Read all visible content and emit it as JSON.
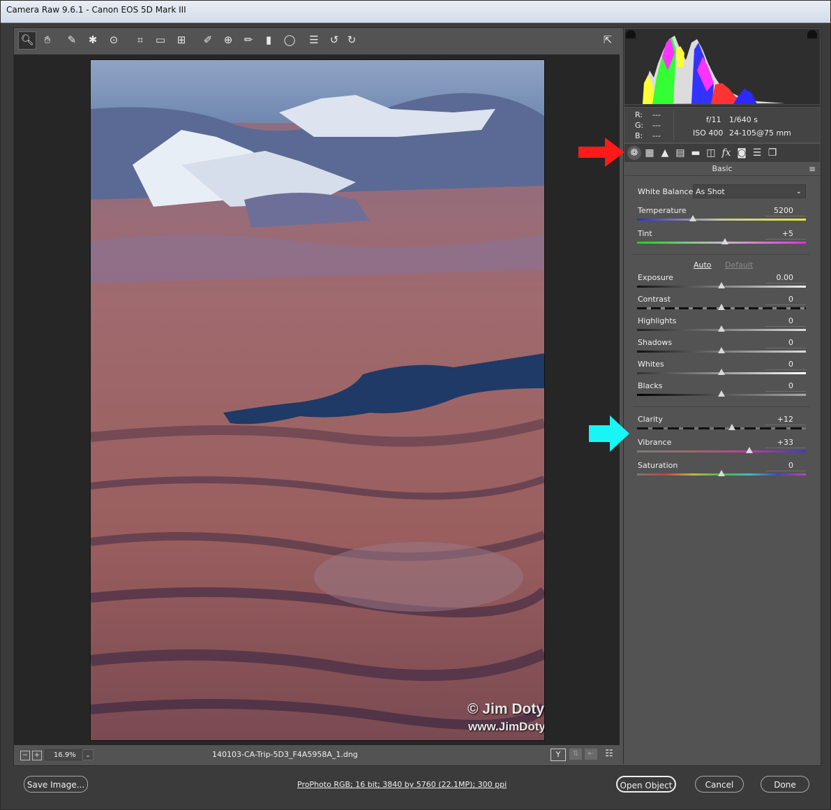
{
  "window": {
    "title": "Camera Raw 9.6.1  -  Canon EOS 5D Mark III"
  },
  "toolbar": {
    "tools": [
      {
        "name": "zoom-tool-icon",
        "glyph": "🔍︎"
      },
      {
        "name": "hand-tool-icon",
        "glyph": "✋︎"
      },
      {
        "name": "white-balance-tool-icon",
        "glyph": "✎"
      },
      {
        "name": "color-sampler-tool-icon",
        "glyph": "✱"
      },
      {
        "name": "targeted-adjustment-tool-icon",
        "glyph": "⊙"
      },
      {
        "name": "crop-tool-icon",
        "glyph": "⌗"
      },
      {
        "name": "straighten-tool-icon",
        "glyph": "▭"
      },
      {
        "name": "transform-tool-icon",
        "glyph": "⊞"
      },
      {
        "name": "spot-removal-tool-icon",
        "glyph": "✐"
      },
      {
        "name": "red-eye-tool-icon",
        "glyph": "⊕"
      },
      {
        "name": "adjustment-brush-icon",
        "glyph": "✏"
      },
      {
        "name": "graduated-filter-icon",
        "glyph": "▮"
      },
      {
        "name": "radial-filter-icon",
        "glyph": "◯"
      },
      {
        "name": "preferences-icon",
        "glyph": "☰"
      },
      {
        "name": "rotate-left-icon",
        "glyph": "↺"
      },
      {
        "name": "rotate-right-icon",
        "glyph": "↻"
      }
    ],
    "export_glyph": "⇱"
  },
  "photo": {
    "watermark_line1": "© Jim Doty, Jr.",
    "watermark_line2": "www.JimDoty.com"
  },
  "status": {
    "zoom": "16.9%",
    "filename": "140103-CA-Trip-5D3_F4A5958A_1.dng",
    "compare_label": "Y",
    "minus_label": "−",
    "plus_label": "+"
  },
  "info": {
    "r_label": "R:",
    "r_value": "---",
    "g_label": "G:",
    "g_value": "---",
    "b_label": "B:",
    "b_value": "---",
    "aperture": "f/11",
    "shutter": "1/640 s",
    "iso": "ISO 400",
    "lens": "24-105@75 mm"
  },
  "panel": {
    "section_title": "Basic",
    "white_balance_label": "White Balance:",
    "white_balance_value": "As Shot",
    "auto_label": "Auto",
    "default_label": "Default",
    "sliders": [
      {
        "key": "temperature",
        "label": "Temperature",
        "value": "5200",
        "level": 0.33
      },
      {
        "key": "tint",
        "label": "Tint",
        "value": "+5",
        "level": 0.52
      },
      {
        "key": "exposure",
        "label": "Exposure",
        "value": "0.00",
        "level": 0.5
      },
      {
        "key": "contrast",
        "label": "Contrast",
        "value": "0",
        "level": 0.5
      },
      {
        "key": "highlights",
        "label": "Highlights",
        "value": "0",
        "level": 0.5
      },
      {
        "key": "shadows",
        "label": "Shadows",
        "value": "0",
        "level": 0.5
      },
      {
        "key": "whites",
        "label": "Whites",
        "value": "0",
        "level": 0.5
      },
      {
        "key": "blacks",
        "label": "Blacks",
        "value": "0",
        "level": 0.5
      },
      {
        "key": "clarity",
        "label": "Clarity",
        "value": "+12",
        "level": 0.56
      },
      {
        "key": "vibrance",
        "label": "Vibrance",
        "value": "+33",
        "level": 0.665
      },
      {
        "key": "saturation",
        "label": "Saturation",
        "value": "0",
        "level": 0.5
      }
    ]
  },
  "footer": {
    "save_label": "Save Image...",
    "workflow_label": "ProPhoto RGB; 16 bit; 3840 by 5760 (22.1MP); 300 ppi",
    "open_label": "Open Object",
    "cancel_label": "Cancel",
    "done_label": "Done"
  },
  "colors": {
    "annotation_red": "#ff1a1a",
    "annotation_cyan": "#19f5f5",
    "panel_bg": "#535353"
  }
}
